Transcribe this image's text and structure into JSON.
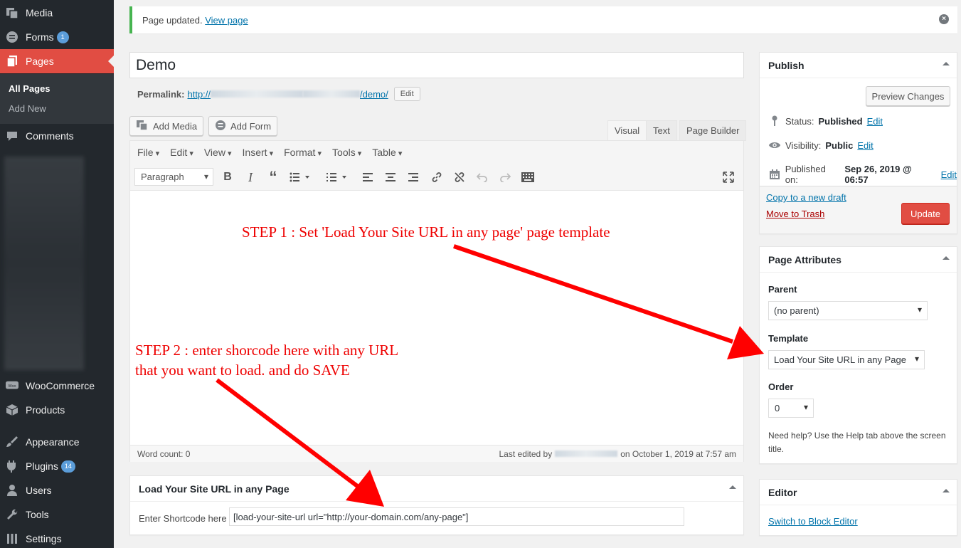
{
  "sidebar": {
    "media": "Media",
    "forms": "Forms",
    "forms_badge": "1",
    "pages": "Pages",
    "all_pages": "All Pages",
    "add_new": "Add New",
    "comments": "Comments",
    "woocommerce": "WooCommerce",
    "products": "Products",
    "appearance": "Appearance",
    "plugins": "Plugins",
    "plugins_badge": "14",
    "users": "Users",
    "tools": "Tools",
    "settings": "Settings"
  },
  "notice": {
    "text": "Page updated.",
    "link": "View page"
  },
  "post": {
    "title": "Demo",
    "permalink_label": "Permalink:",
    "permalink_start": "http://",
    "permalink_end": "/demo/",
    "edit_button": "Edit"
  },
  "editor": {
    "add_media": "Add Media",
    "add_form": "Add Form",
    "tabs": [
      "Visual",
      "Text",
      "Page Builder"
    ],
    "menu": [
      "File",
      "Edit",
      "View",
      "Insert",
      "Format",
      "Tools",
      "Table"
    ],
    "format": "Paragraph",
    "word_count": "Word count: 0",
    "last_edited_prefix": "Last edited by",
    "last_edited_suffix": "on October 1, 2019 at 7:57 am"
  },
  "annotations": {
    "step1": "STEP 1 : Set 'Load Your Site URL in any page' page template",
    "step2_line1": "STEP 2 : enter shorcode here with any URL",
    "step2_line2": "that you want to load. and do SAVE",
    "color": "#ff0000"
  },
  "shortcode_box": {
    "title": "Load Your Site URL in any Page",
    "label": "Enter Shortcode here",
    "value": "[load-your-site-url url=\"http://your-domain.com/any-page\"]"
  },
  "publish": {
    "title": "Publish",
    "preview": "Preview Changes",
    "status_label": "Status:",
    "status_value": "Published",
    "visibility_label": "Visibility:",
    "visibility_value": "Public",
    "published_label": "Published on:",
    "published_value": "Sep 26, 2019 @ 06:57",
    "edit": "Edit",
    "copy_draft": "Copy to a new draft",
    "trash": "Move to Trash",
    "update": "Update"
  },
  "attributes": {
    "title": "Page Attributes",
    "parent_label": "Parent",
    "parent_value": "(no parent)",
    "template_label": "Template",
    "template_value": "Load Your Site URL in any Page",
    "order_label": "Order",
    "order_value": "0",
    "help": "Need help? Use the Help tab above the screen title."
  },
  "editor_box": {
    "title": "Editor",
    "switch": "Switch to Block Editor"
  },
  "colors": {
    "accent": "#e14d43",
    "sidebar": "#23282d",
    "link": "#0073aa"
  }
}
